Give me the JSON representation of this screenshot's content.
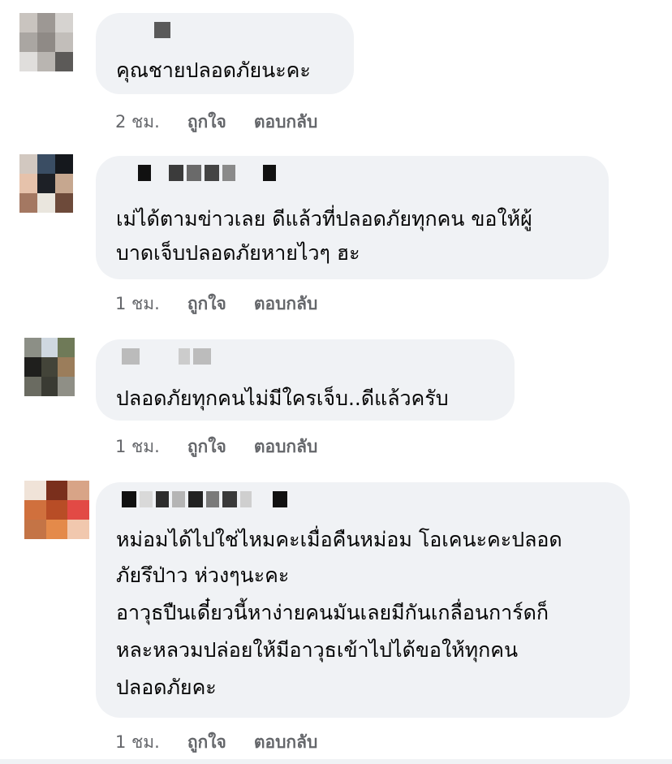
{
  "comments": [
    {
      "lines": [
        "คุณชายปลอดภัยนะคะ"
      ],
      "time": "2 ชม.",
      "like": "ถูกใจ",
      "reply": "ตอบกลับ"
    },
    {
      "lines": [
        "เม่ได้ตามข่าวเลย ดีแล้วที่ปลอดภัยทุกคน ขอให้ผู้",
        "บาดเจ็บปลอดภัยหายไวๆ ฮะ"
      ],
      "time": "1 ชม.",
      "like": "ถูกใจ",
      "reply": "ตอบกลับ"
    },
    {
      "lines": [
        "ปลอดภัยทุกคนไม่มีใครเจ็บ..ดีแล้วครับ"
      ],
      "time": "1 ชม.",
      "like": "ถูกใจ",
      "reply": "ตอบกลับ"
    },
    {
      "lines": [
        "หม่อมได้ไปใช่ไหมคะเมื่อคืนหม่อม โอเคนะคะปลอด",
        "ภัยรึป่าว ห่วงๆนะคะ",
        "อาวุธปืนเดี๋ยวนี้หาง่ายคนมันเลยมีกันเกลื่อนการ์ดก็",
        "หละหลวมปล่อยให้มีอาวุธเข้าไปได้ขอให้ทุกคน",
        "ปลอดภัยคะ"
      ],
      "time": "1 ชม.",
      "like": "ถูกใจ",
      "reply": "ตอบกลับ"
    }
  ]
}
